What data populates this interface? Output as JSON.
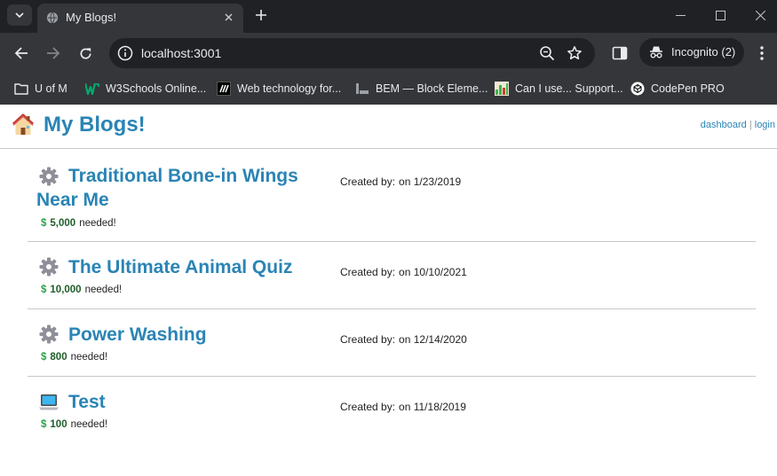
{
  "browser": {
    "tab_title": "My Blogs!",
    "url": "localhost:3001",
    "incognito_label": "Incognito (2)",
    "bookmarks": [
      {
        "label": "U of M",
        "icon": "folder-icon"
      },
      {
        "label": "W3Schools Online...",
        "icon": "w3schools-icon"
      },
      {
        "label": "Web technology for...",
        "icon": "mdn-icon"
      },
      {
        "label": "BEM — Block Eleme...",
        "icon": "bem-icon"
      },
      {
        "label": "Can I use... Support...",
        "icon": "caniuse-icon"
      },
      {
        "label": "CodePen PRO",
        "icon": "codepen-icon"
      }
    ]
  },
  "site": {
    "title": "My Blogs!",
    "nav_dashboard": "dashboard",
    "nav_separator": "|",
    "nav_login": "login"
  },
  "posts": [
    {
      "icon": "gear-icon",
      "title": "Traditional Bone-in Wings Near Me",
      "created_label": "Created by:",
      "created_on": "on 1/23/2019",
      "dollar": "$",
      "amount": "5,000",
      "needed": "needed!"
    },
    {
      "icon": "gear-icon",
      "title": "The Ultimate Animal Quiz",
      "created_label": "Created by:",
      "created_on": "on 10/10/2021",
      "dollar": "$",
      "amount": "10,000",
      "needed": "needed!"
    },
    {
      "icon": "gear-icon",
      "title": "Power Washing",
      "created_label": "Created by:",
      "created_on": "on 12/14/2020",
      "dollar": "$",
      "amount": "800",
      "needed": "needed!"
    },
    {
      "icon": "laptop-icon",
      "title": "Test",
      "created_label": "Created by:",
      "created_on": "on 11/18/2019",
      "dollar": "$",
      "amount": "100",
      "needed": "needed!"
    }
  ],
  "colors": {
    "link": "#2a84b5",
    "dollar": "#2aa14a",
    "chrome_dark": "#202124",
    "chrome_mid": "#35363a"
  }
}
